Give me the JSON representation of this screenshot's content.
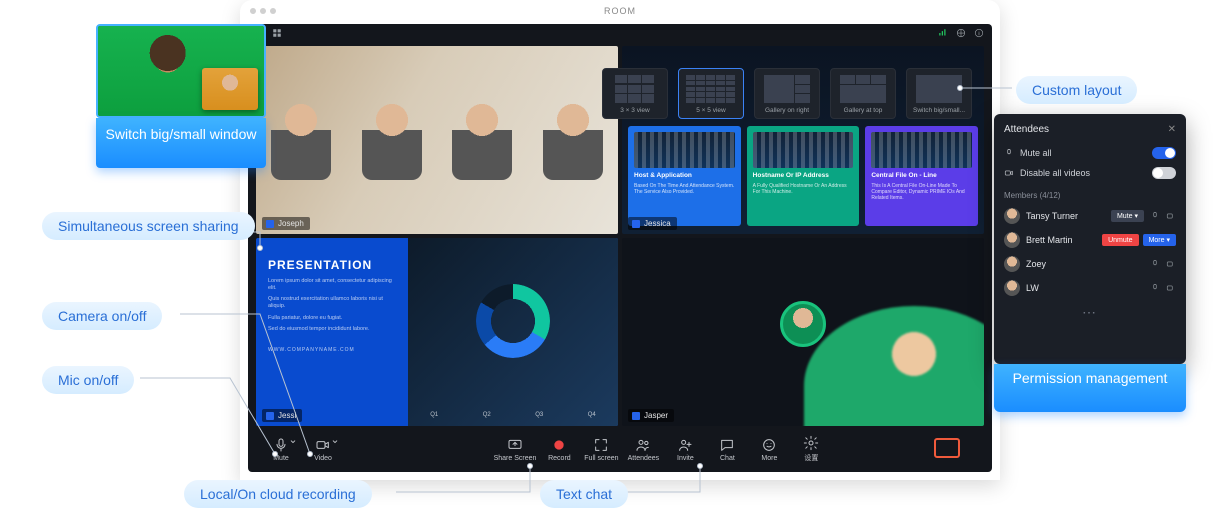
{
  "window": {
    "title": "ROOM"
  },
  "layout_options": [
    {
      "label": "3 × 3 view"
    },
    {
      "label": "5 × 5 view"
    },
    {
      "label": "Gallery on right"
    },
    {
      "label": "Gallery at top"
    },
    {
      "label": "Switch big/small..."
    }
  ],
  "tiles": {
    "t1": {
      "name": "Joseph"
    },
    "t2": {
      "name": "Jessica",
      "cards": [
        {
          "title": "Host & Application",
          "desc": "Based On The Time And Attendance System. The Service Also Provided."
        },
        {
          "title": "Hostname Or IP Address",
          "desc": "A Fully Qualified Hostname Or An Address For This Machine."
        },
        {
          "title": "Central File On - Line",
          "desc": "This Is A Central File On-Line Made To Compare Editor, Dynamic PRIME IOs And Related Items."
        }
      ]
    },
    "t3": {
      "name": "Jessi",
      "slide": {
        "heading": "PRESENTATION",
        "body1": "Lorem ipsum dolor sit amet, consectetur adipiscing elit.",
        "body2": "Quis nostrud exercitation ullamco laboris nisi ut aliquip.",
        "body3": "Fulla pariatur, dolore eu fugiat.",
        "body4": "Sed do eiusmod tempor incididunt labore.",
        "footer": "WWW.COMPANYNAME.COM",
        "q1": "Q1",
        "q2": "Q2",
        "q3": "Q3",
        "q4": "Q4"
      }
    },
    "t4": {
      "name": "Jasper"
    }
  },
  "toolbar": {
    "mute": "Mute",
    "video": "Video",
    "share": "Share Screen",
    "record": "Record",
    "fullscreen": "Full screen",
    "attendees": "Attendees",
    "invite": "Invite",
    "chat": "Chat",
    "more": "More",
    "settings": "设置"
  },
  "attendees": {
    "title": "Attendees",
    "mute_all": "Mute all",
    "disable_videos": "Disable all videos",
    "section": "Members (4/12)",
    "m1": "Tansy Turner",
    "m2": "Brett Martin",
    "m3": "Zoey",
    "m4": "LW",
    "btn_unmute": "Unmute",
    "btn_more": "More ▾",
    "btn_mute": "Mute ▾"
  },
  "callouts": {
    "switch": "Switch big/small window",
    "sss": "Simultaneous screen sharing",
    "camera": "Camera on/off",
    "mic": "Mic on/off",
    "recording": "Local/On cloud recording",
    "chat": "Text chat",
    "layout": "Custom layout",
    "permission": "Permission management"
  }
}
